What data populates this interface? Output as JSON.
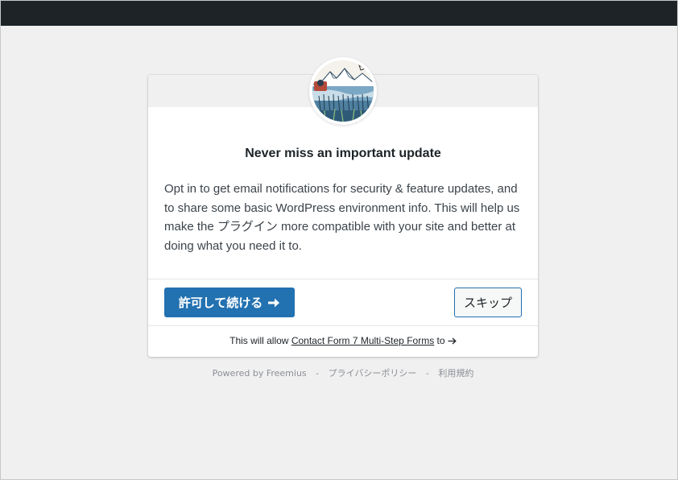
{
  "dialog": {
    "title": "Never miss an important update",
    "body": "Opt in to get email notifications for security & feature updates, and to share some basic WordPress environment info. This will help us make the プラグイン more compatible with your site and better at doing what you need it to.",
    "allow_button_label": "許可して続ける",
    "allow_button_icon": "arrow-right-icon",
    "skip_button_label": "スキップ",
    "permissions_prefix": "This will allow",
    "permissions_link": "Contact Form 7 Multi-Step Forms",
    "permissions_suffix": "to",
    "permissions_icon": "arrow-right-icon",
    "avatar_icon": "plugin-logo-landscape-icon"
  },
  "footer": {
    "powered_by": "Powered by Freemius",
    "separator": "-",
    "privacy_link": "プライバシーポリシー",
    "terms_link": "利用規約"
  },
  "colors": {
    "admin_bar": "#1d2327",
    "primary": "#2271b1",
    "background": "#f0f0f1"
  }
}
